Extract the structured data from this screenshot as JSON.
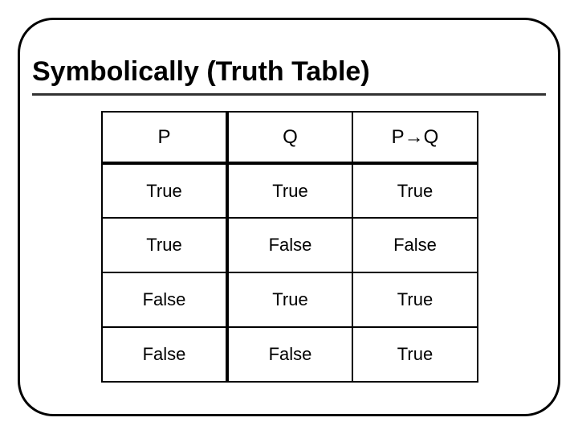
{
  "title": "Symbolically (Truth Table)",
  "headers": {
    "c0": "P",
    "c1": "Q",
    "c2": "P→Q"
  },
  "rows": [
    {
      "c0": "True",
      "c1": "True",
      "c2": "True"
    },
    {
      "c0": "True",
      "c1": "False",
      "c2": "False"
    },
    {
      "c0": "False",
      "c1": "True",
      "c2": "True"
    },
    {
      "c0": "False",
      "c1": "False",
      "c2": "True"
    }
  ],
  "chart_data": {
    "type": "table",
    "title": "Symbolically (Truth Table)",
    "columns": [
      "P",
      "Q",
      "P→Q"
    ],
    "rows": [
      [
        "True",
        "True",
        "True"
      ],
      [
        "True",
        "False",
        "False"
      ],
      [
        "False",
        "True",
        "True"
      ],
      [
        "False",
        "False",
        "True"
      ]
    ]
  }
}
